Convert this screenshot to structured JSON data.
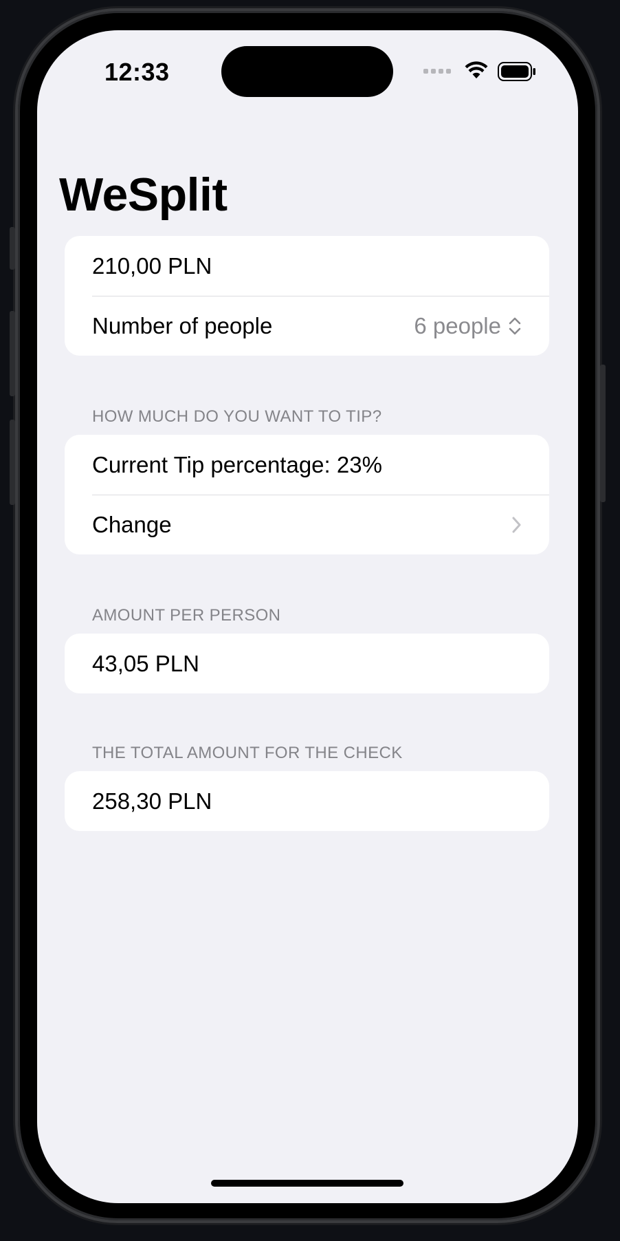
{
  "status_bar": {
    "time": "12:33"
  },
  "nav": {
    "title": "WeSplit"
  },
  "input_section": {
    "amount": "210,00 PLN",
    "people_label": "Number of people",
    "people_value": "6 people"
  },
  "tip_section": {
    "header": "HOW MUCH DO YOU WANT TO TIP?",
    "current_tip": "Current Tip percentage: 23%",
    "change_label": "Change"
  },
  "per_person_section": {
    "header": "AMOUNT PER PERSON",
    "value": "43,05 PLN"
  },
  "total_section": {
    "header": "THE TOTAL AMOUNT FOR THE CHECK",
    "value": "258,30 PLN"
  },
  "icons": [
    "wifi-icon",
    "battery-icon",
    "signal-icon",
    "up-down-chevron-icon",
    "chevron-right-icon"
  ]
}
